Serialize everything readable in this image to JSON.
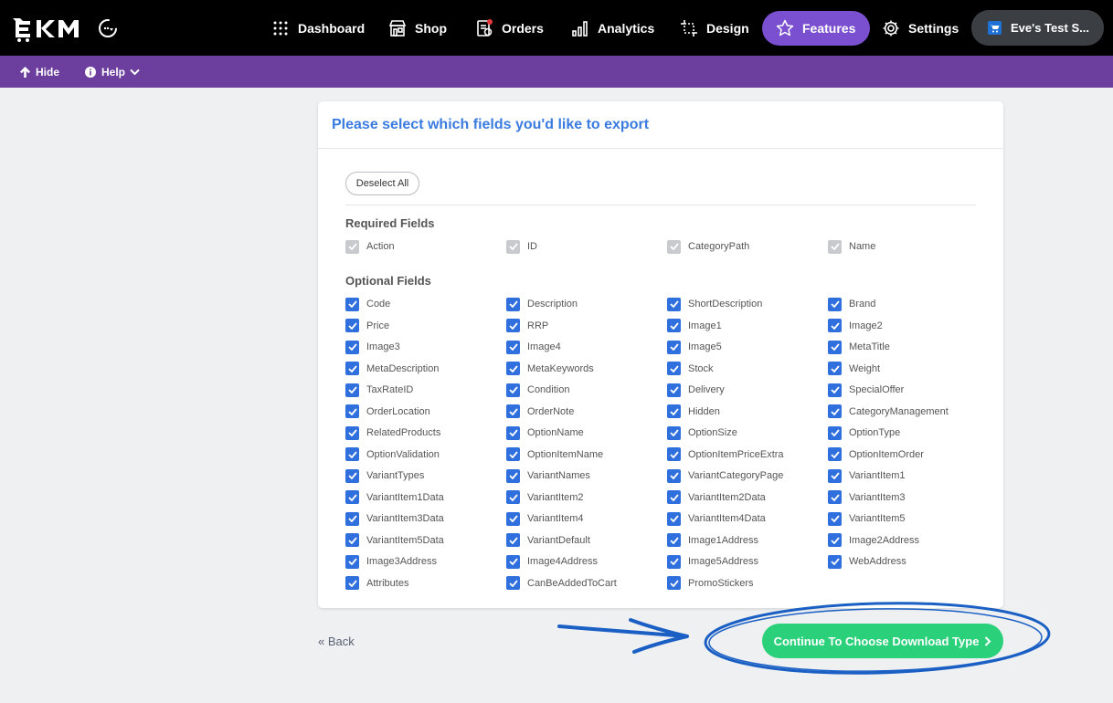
{
  "topnav": {
    "logo_text": "EKM",
    "items": [
      {
        "label": "Dashboard",
        "icon": "grid-dots-icon"
      },
      {
        "label": "Shop",
        "icon": "storefront-icon"
      },
      {
        "label": "Orders",
        "icon": "orders-document-icon"
      },
      {
        "label": "Analytics",
        "icon": "bar-chart-icon"
      },
      {
        "label": "Design",
        "icon": "design-crop-icon"
      },
      {
        "label": "Features",
        "icon": "star-icon",
        "active": true
      },
      {
        "label": "Settings",
        "icon": "gear-icon"
      }
    ],
    "shop_name": "Eve's Test S..."
  },
  "subbar": {
    "hide_label": "Hide",
    "help_label": "Help"
  },
  "card": {
    "title": "Please select which fields you'd like to export",
    "deselect_label": "Deselect All",
    "required_heading": "Required Fields",
    "optional_heading": "Optional Fields",
    "required_fields": [
      "Action",
      "ID",
      "CategoryPath",
      "Name"
    ],
    "optional_fields": [
      "Code",
      "Description",
      "ShortDescription",
      "Brand",
      "Price",
      "RRP",
      "Image1",
      "Image2",
      "Image3",
      "Image4",
      "Image5",
      "MetaTitle",
      "MetaDescription",
      "MetaKeywords",
      "Stock",
      "Weight",
      "TaxRateID",
      "Condition",
      "Delivery",
      "SpecialOffer",
      "OrderLocation",
      "OrderNote",
      "Hidden",
      "CategoryManagement",
      "RelatedProducts",
      "OptionName",
      "OptionSize",
      "OptionType",
      "OptionValidation",
      "OptionItemName",
      "OptionItemPriceExtra",
      "OptionItemOrder",
      "VariantTypes",
      "VariantNames",
      "VariantCategoryPage",
      "VariantItem1",
      "VariantItem1Data",
      "VariantItem2",
      "VariantItem2Data",
      "VariantItem3",
      "VariantItem3Data",
      "VariantItem4",
      "VariantItem4Data",
      "VariantItem5",
      "VariantItem5Data",
      "VariantDefault",
      "Image1Address",
      "Image2Address",
      "Image3Address",
      "Image4Address",
      "Image5Address",
      "WebAddress",
      "Attributes",
      "CanBeAddedToCart",
      "PromoStickers"
    ]
  },
  "footer": {
    "back_label": "« Back",
    "continue_label": "Continue To Choose Download Type"
  },
  "colors": {
    "accent_blue": "#2f6fde",
    "title_blue": "#3a7be0",
    "purple_bar": "#6c3f9e",
    "active_nav": "#7a4fd0",
    "continue_green": "#2ad07a",
    "annotation_blue": "#1a5fc4"
  }
}
